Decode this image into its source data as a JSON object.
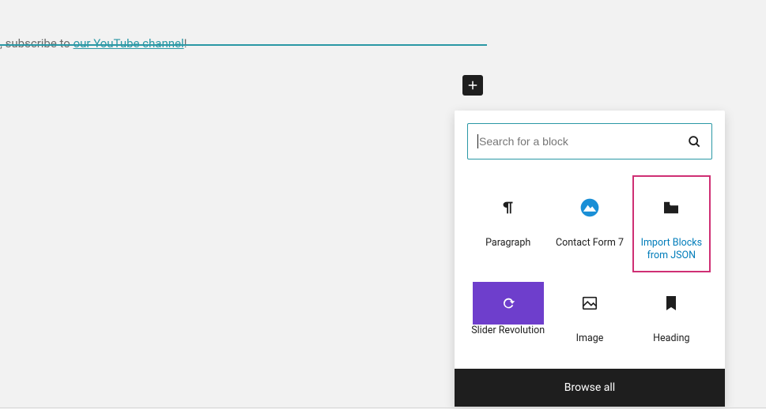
{
  "prompt": {
    "prefix": ", subscribe to ",
    "link": "our YouTube channel",
    "suffix": "!"
  },
  "inserter": {
    "add_icon_name": "plus-icon",
    "search": {
      "placeholder": "Search for a block"
    },
    "blocks": [
      {
        "key": "paragraph",
        "label": "Paragraph",
        "highlight": false,
        "accent": false
      },
      {
        "key": "contact-form-7",
        "label": "Contact Form 7",
        "highlight": false,
        "accent": false
      },
      {
        "key": "import-blocks",
        "label": "Import Blocks from JSON",
        "highlight": true,
        "accent": true
      },
      {
        "key": "slider-revolution",
        "label": "Slider Revolution",
        "highlight": false,
        "accent": false
      },
      {
        "key": "image",
        "label": "Image",
        "highlight": false,
        "accent": false
      },
      {
        "key": "heading",
        "label": "Heading",
        "highlight": false,
        "accent": false
      }
    ],
    "browse_all": "Browse all"
  }
}
